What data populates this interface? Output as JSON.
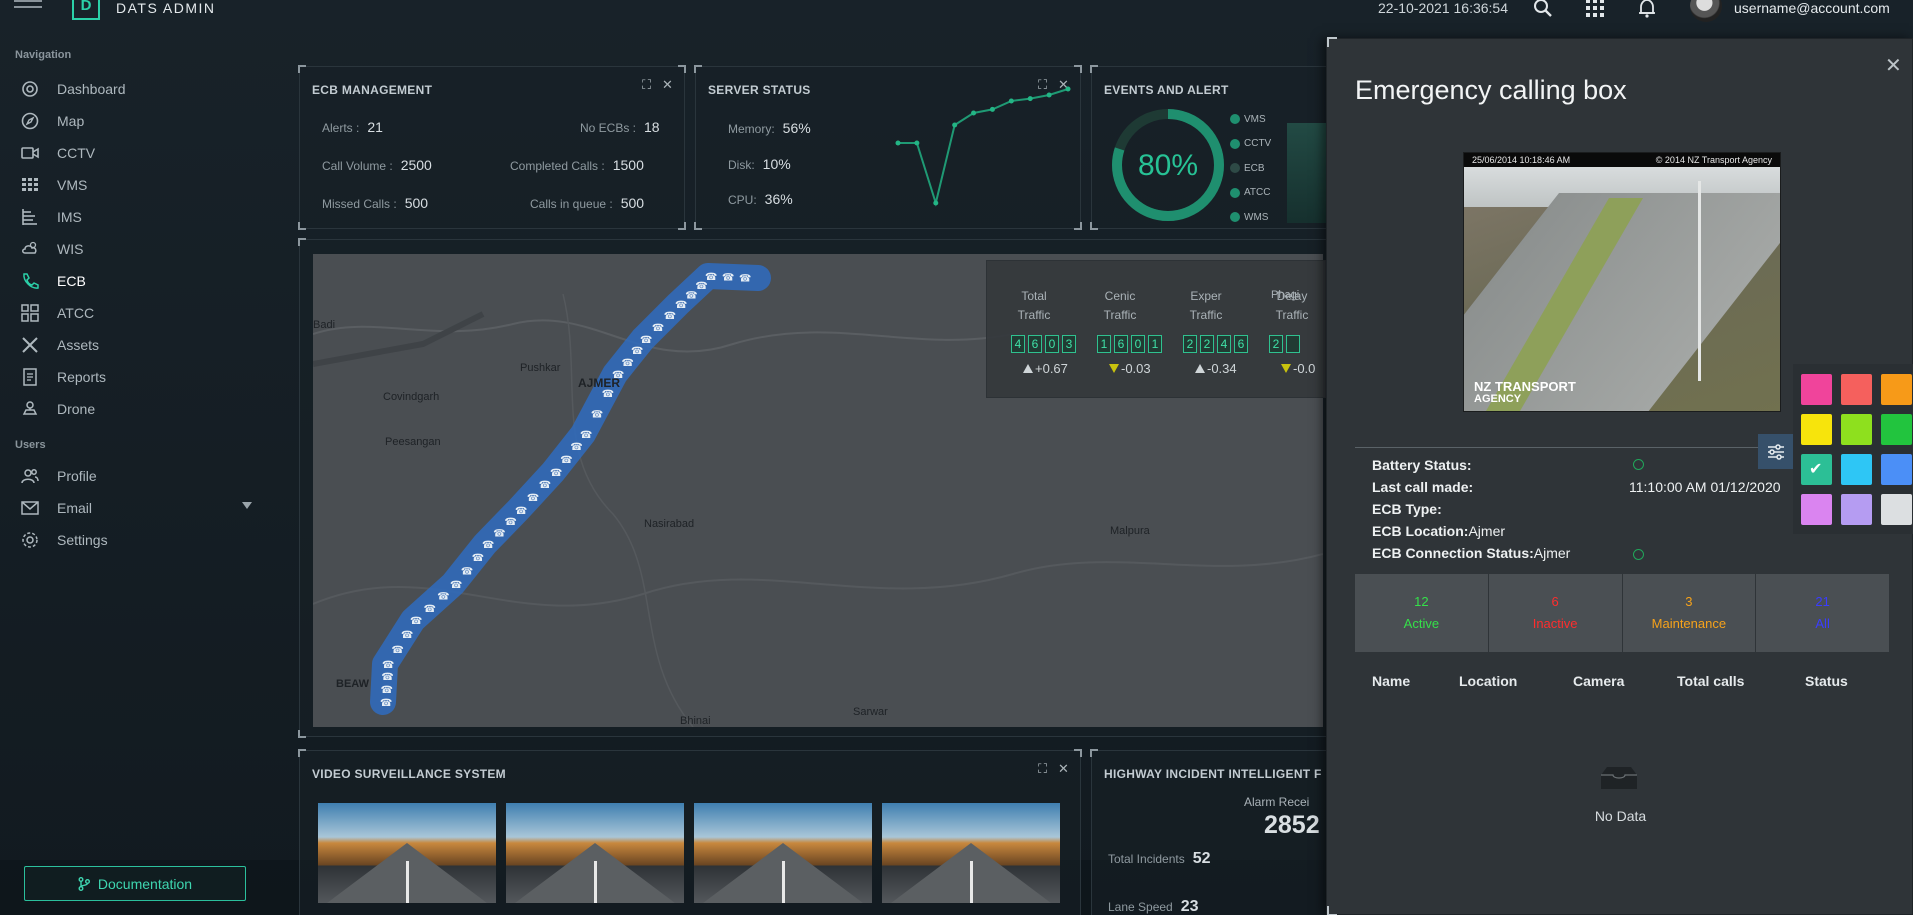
{
  "topbar": {
    "brand": "DATS ADMIN",
    "logo_letter": "D",
    "datetime": "22-10-2021 16:36:54",
    "user_email": "username@account.com"
  },
  "sidebar": {
    "nav_heading": "Navigation",
    "users_heading": "Users",
    "items": [
      {
        "label": "Dashboard",
        "icon": "dashboard-icon"
      },
      {
        "label": "Map",
        "icon": "compass-icon"
      },
      {
        "label": "CCTV",
        "icon": "camera-icon"
      },
      {
        "label": "VMS",
        "icon": "grid-icon"
      },
      {
        "label": "IMS",
        "icon": "list-icon"
      },
      {
        "label": "WIS",
        "icon": "weather-icon"
      },
      {
        "label": "ECB",
        "icon": "phone-icon",
        "active": true
      },
      {
        "label": "ATCC",
        "icon": "blocks-icon"
      },
      {
        "label": "Assets",
        "icon": "tools-icon"
      },
      {
        "label": "Reports",
        "icon": "report-icon"
      },
      {
        "label": "Drone",
        "icon": "drone-icon"
      }
    ],
    "user_items": [
      {
        "label": "Profile",
        "icon": "users-icon"
      },
      {
        "label": "Email",
        "icon": "mail-icon"
      },
      {
        "label": "Settings",
        "icon": "gear-icon"
      }
    ],
    "documentation_label": "Documentation"
  },
  "ecb_management": {
    "title": "ECB MANAGEMENT",
    "alerts_label": "Alerts :",
    "alerts": "21",
    "no_ecbs_label": "No ECBs :",
    "no_ecbs": "18",
    "call_volume_label": "Call Volume :",
    "call_volume": "2500",
    "completed_label": "Completed Calls :",
    "completed": "1500",
    "missed_label": "Missed Calls :",
    "missed": "500",
    "queue_label": "Calls in queue :",
    "queue": "500"
  },
  "server_status": {
    "title": "SERVER STATUS",
    "memory_label": "Memory:",
    "memory": "56%",
    "disk_label": "Disk:",
    "disk": "10%",
    "cpu_label": "CPU:",
    "cpu": "36%",
    "sparkline": [
      55,
      55,
      5,
      70,
      80,
      83,
      90,
      92,
      95,
      100
    ]
  },
  "events": {
    "title": "EVENTS AND ALERT",
    "percent": "80%",
    "percent_value": 0.8,
    "legend": [
      "VMS",
      "CCTV",
      "ECB",
      "ATCC",
      "WMS"
    ]
  },
  "map": {
    "labels": [
      "Badi",
      "Pushkar",
      "AJMER",
      "Covindgarh",
      "Peesangan",
      "Nasirabad",
      "Malpura",
      "BEAW",
      "Bhinai",
      "Sarwar",
      "Phagi"
    ]
  },
  "traffic": {
    "columns": [
      {
        "l1": "Total",
        "l2": "Traffic",
        "digits": [
          "4",
          "6",
          "0",
          "3"
        ],
        "delta": "+0.67",
        "dir": "up"
      },
      {
        "l1": "Cenic",
        "l2": "Traffic",
        "digits": [
          "1",
          "6",
          "0",
          "1"
        ],
        "delta": "-0.03",
        "dir": "down"
      },
      {
        "l1": "Exper",
        "l2": "Traffic",
        "digits": [
          "2",
          "2",
          "4",
          "6"
        ],
        "delta": "-0.34",
        "dir": "up"
      },
      {
        "l1": "Delay",
        "l2": "Traffic",
        "digits": [
          "2",
          ""
        ],
        "delta": "-0.0",
        "dir": "down"
      }
    ]
  },
  "video": {
    "title": "VIDEO SURVEILLANCE SYSTEM"
  },
  "highway": {
    "title": "HIGHWAY INCIDENT INTELLIGENT F",
    "alarm_label": "Alarm Recei",
    "alarm_value": "2852",
    "total_incidents_label": "Total Incidents",
    "total_incidents": "52",
    "lane_speed_label": "Lane Speed",
    "lane_speed": "23"
  },
  "modal": {
    "title": "Emergency calling box",
    "cam_date": "25/06/2014 10:18:46 AM",
    "cam_copyright": "© 2014 NZ Transport Agency",
    "cam_logo_line1": "NZ TRANSPORT",
    "cam_logo_line2": "AGENCY",
    "battery_label": "Battery Status:",
    "last_call_label": "Last call made:",
    "last_call_value": "11:10:00 AM 01/12/2020",
    "type_label": "ECB Type:",
    "location_label": "ECB Location:",
    "location_value": "Ajmer",
    "connection_label": "ECB Connection Status:",
    "connection_value": "Ajmer",
    "counts": [
      {
        "value": "12",
        "label": "Active",
        "color": "#35e04a"
      },
      {
        "value": "6",
        "label": "Inactive",
        "color": "#ff2d2d"
      },
      {
        "value": "3",
        "label": "Maintenance",
        "color": "#f5a21b"
      },
      {
        "value": "21",
        "label": "All",
        "color": "#3a3cff"
      }
    ],
    "table_headers": [
      "Name",
      "Location",
      "Camera",
      "Total calls",
      "Status"
    ],
    "no_data": "No Data"
  },
  "color_picker": {
    "swatches": [
      "#f0449b",
      "#f5605d",
      "#f79a18",
      "#f7e40c",
      "#8ee01e",
      "#22c43e",
      "#2cbf96",
      "#2ec6f5",
      "#4b8ff7",
      "#da84f0",
      "#b59cf2",
      "#dcdfe1"
    ],
    "selected_index": 6
  }
}
